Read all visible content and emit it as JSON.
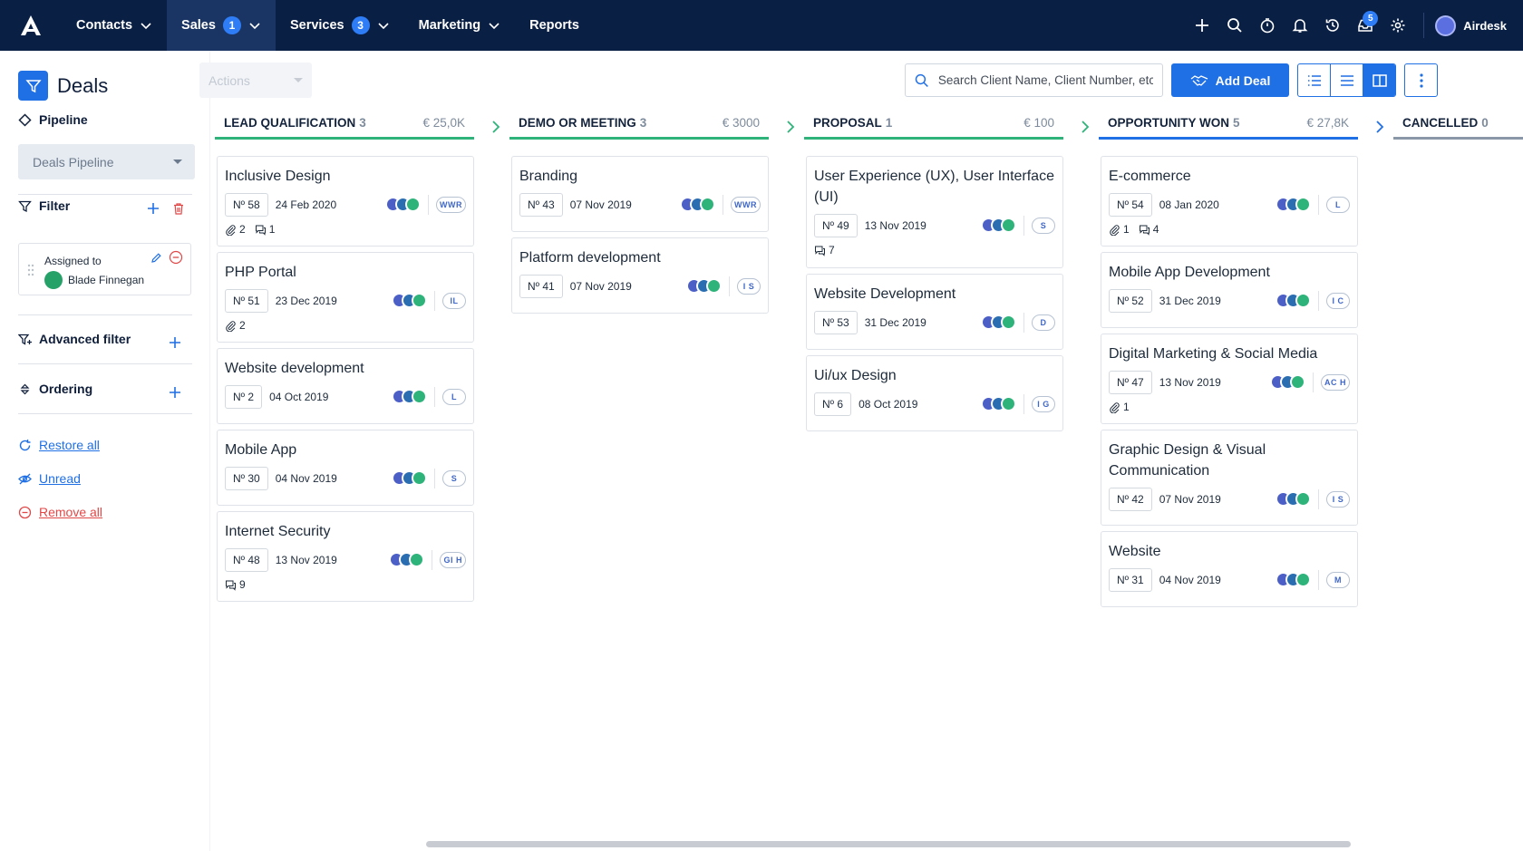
{
  "nav": {
    "items": [
      {
        "label": "Contacts",
        "badge": null,
        "dropdown": true
      },
      {
        "label": "Sales",
        "badge": "1",
        "dropdown": true,
        "active": true
      },
      {
        "label": "Services",
        "badge": "3",
        "dropdown": true
      },
      {
        "label": "Marketing",
        "badge": null,
        "dropdown": true
      },
      {
        "label": "Reports",
        "badge": null,
        "dropdown": false
      }
    ],
    "notifications_badge": "5",
    "account_name": "Airdesk"
  },
  "sidebar": {
    "title": "Deals",
    "pipeline_label": "Pipeline",
    "pipeline_value": "Deals Pipeline",
    "filter_label": "Filter",
    "filter_card": {
      "label": "Assigned to",
      "user": "Blade Finnegan"
    },
    "advanced_filter_label": "Advanced filter",
    "ordering_label": "Ordering",
    "restore_all": "Restore all",
    "unread": "Unread",
    "remove_all": "Remove all"
  },
  "toolbar": {
    "actions_label": "Actions",
    "search_placeholder": "Search Client Name, Client Number, etc...",
    "add_deal_label": "Add Deal"
  },
  "colors": {
    "lead": "#2eb37a",
    "demo": "#2eb37a",
    "proposal": "#2eb37a",
    "won": "#1f6fe5",
    "cancelled": "#8a97a8"
  },
  "columns": [
    {
      "name": "LEAD QUALIFICATION",
      "count": "3",
      "amount": "€ 25,0K",
      "cards": [
        {
          "title": "Inclusive Design",
          "number": "Nº 58",
          "date": "24 Feb 2020",
          "company": "WWR",
          "attachments": "2",
          "comments": "1"
        },
        {
          "title": "PHP Portal",
          "number": "Nº 51",
          "date": "23 Dec 2019",
          "company": "IL",
          "attachments": "2",
          "comments": null
        },
        {
          "title": "Website development",
          "number": "Nº 2",
          "date": "04 Oct 2019",
          "company": "L",
          "attachments": null,
          "comments": null
        },
        {
          "title": "Mobile App",
          "number": "Nº 30",
          "date": "04 Nov 2019",
          "company": "S",
          "attachments": null,
          "comments": null
        },
        {
          "title": "Internet Security",
          "number": "Nº 48",
          "date": "13 Nov 2019",
          "company": "GI H",
          "attachments": null,
          "comments": "9"
        }
      ]
    },
    {
      "name": "DEMO OR MEETING",
      "count": "3",
      "amount": "€ 3000",
      "cards": [
        {
          "title": "Branding",
          "number": "Nº 43",
          "date": "07 Nov 2019",
          "company": "WWR",
          "attachments": null,
          "comments": null
        },
        {
          "title": "Platform development",
          "number": "Nº 41",
          "date": "07 Nov 2019",
          "company": "I S",
          "attachments": null,
          "comments": null
        }
      ]
    },
    {
      "name": "PROPOSAL",
      "count": "1",
      "amount": "€ 100",
      "cards": [
        {
          "title": "User Experience (UX), User Interface (UI)",
          "number": "Nº 49",
          "date": "13 Nov 2019",
          "company": "S",
          "attachments": null,
          "comments": "7"
        },
        {
          "title": "Website Development",
          "number": "Nº 53",
          "date": "31 Dec 2019",
          "company": "D",
          "attachments": null,
          "comments": null
        },
        {
          "title": "Ui/ux Design",
          "number": "Nº 6",
          "date": "08 Oct 2019",
          "company": "I G",
          "attachments": null,
          "comments": null
        }
      ]
    },
    {
      "name": "OPPORTUNITY WON",
      "count": "5",
      "amount": "€ 27,8K",
      "cards": [
        {
          "title": "E-commerce",
          "number": "Nº 54",
          "date": "08 Jan 2020",
          "company": "L",
          "attachments": "1",
          "comments": "4"
        },
        {
          "title": "Mobile App Development",
          "number": "Nº 52",
          "date": "31 Dec 2019",
          "company": "I C",
          "attachments": null,
          "comments": null
        },
        {
          "title": "Digital Marketing & Social Media",
          "number": "Nº 47",
          "date": "13 Nov 2019",
          "company": "AC H",
          "attachments": "1",
          "comments": null
        },
        {
          "title": "Graphic Design & Visual Communication",
          "number": "Nº 42",
          "date": "07 Nov 2019",
          "company": "I S",
          "attachments": null,
          "comments": null
        },
        {
          "title": "Website",
          "number": "Nº 31",
          "date": "04 Nov 2019",
          "company": "M",
          "attachments": null,
          "comments": null
        }
      ]
    },
    {
      "name": "CANCELLED",
      "count": "0",
      "amount": "",
      "cards": []
    }
  ]
}
